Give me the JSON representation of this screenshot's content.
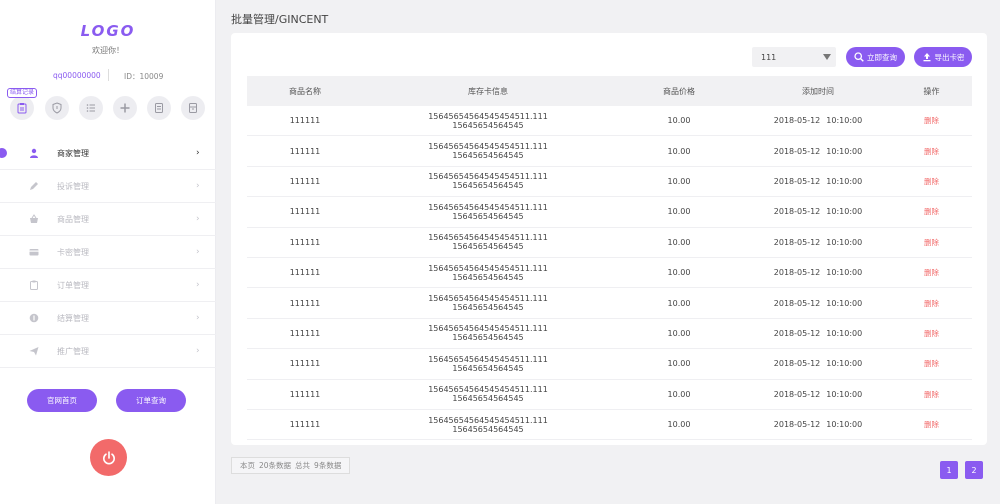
{
  "sidebar": {
    "logo": "LOGO",
    "welcome": "欢迎你！",
    "account_name": "qq00000000",
    "account_id": "ID：10009",
    "quick_tag": "结算记录",
    "menu": [
      {
        "label": "商家管理",
        "icon": "user-icon",
        "active": true
      },
      {
        "label": "投诉管理",
        "icon": "pencil-icon",
        "active": false
      },
      {
        "label": "商品管理",
        "icon": "basket-icon",
        "active": false
      },
      {
        "label": "卡密管理",
        "icon": "card-icon",
        "active": false
      },
      {
        "label": "订单管理",
        "icon": "clipboard-icon",
        "active": false
      },
      {
        "label": "结算管理",
        "icon": "coin-icon",
        "active": false
      },
      {
        "label": "推广管理",
        "icon": "paper-plane-icon",
        "active": false
      }
    ],
    "btn_home": "官网首页",
    "btn_order": "订单查询"
  },
  "header": {
    "title": "批量管理/GINCENT"
  },
  "toolbar": {
    "select_value": "111",
    "search_label": "立即查询",
    "export_label": "导出卡密"
  },
  "table": {
    "columns": [
      "商品名称",
      "库存卡信息",
      "商品价格",
      "添加时间",
      "操作"
    ],
    "rows": [
      {
        "name": "111111",
        "card_line1": "15645654564545454511.111",
        "card_line2": "15645654564545",
        "price": "10.00",
        "date": "2018-05-12",
        "time": "10:10:00",
        "action": "删除"
      },
      {
        "name": "111111",
        "card_line1": "15645654564545454511.111",
        "card_line2": "15645654564545",
        "price": "10.00",
        "date": "2018-05-12",
        "time": "10:10:00",
        "action": "删除"
      },
      {
        "name": "111111",
        "card_line1": "15645654564545454511.111",
        "card_line2": "15645654564545",
        "price": "10.00",
        "date": "2018-05-12",
        "time": "10:10:00",
        "action": "删除"
      },
      {
        "name": "111111",
        "card_line1": "15645654564545454511.111",
        "card_line2": "15645654564545",
        "price": "10.00",
        "date": "2018-05-12",
        "time": "10:10:00",
        "action": "删除"
      },
      {
        "name": "111111",
        "card_line1": "15645654564545454511.111",
        "card_line2": "15645654564545",
        "price": "10.00",
        "date": "2018-05-12",
        "time": "10:10:00",
        "action": "删除"
      },
      {
        "name": "111111",
        "card_line1": "15645654564545454511.111",
        "card_line2": "15645654564545",
        "price": "10.00",
        "date": "2018-05-12",
        "time": "10:10:00",
        "action": "删除"
      },
      {
        "name": "111111",
        "card_line1": "15645654564545454511.111",
        "card_line2": "15645654564545",
        "price": "10.00",
        "date": "2018-05-12",
        "time": "10:10:00",
        "action": "删除"
      },
      {
        "name": "111111",
        "card_line1": "15645654564545454511.111",
        "card_line2": "15645654564545",
        "price": "10.00",
        "date": "2018-05-12",
        "time": "10:10:00",
        "action": "删除"
      },
      {
        "name": "111111",
        "card_line1": "15645654564545454511.111",
        "card_line2": "15645654564545",
        "price": "10.00",
        "date": "2018-05-12",
        "time": "10:10:00",
        "action": "删除"
      },
      {
        "name": "111111",
        "card_line1": "15645654564545454511.111",
        "card_line2": "15645654564545",
        "price": "10.00",
        "date": "2018-05-12",
        "time": "10:10:00",
        "action": "删除"
      },
      {
        "name": "111111",
        "card_line1": "15645654564545454511.111",
        "card_line2": "15645654564545",
        "price": "10.00",
        "date": "2018-05-12",
        "time": "10:10:00",
        "action": "删除"
      }
    ]
  },
  "pagination": {
    "info_page": "本页",
    "info_count": "20条数据",
    "info_total": "总共",
    "info_total_count": "9条数据",
    "pages": [
      "1",
      "2"
    ]
  },
  "colors": {
    "accent": "#8a5bf0",
    "danger": "#f26a6a",
    "background": "#f1f1f3"
  }
}
